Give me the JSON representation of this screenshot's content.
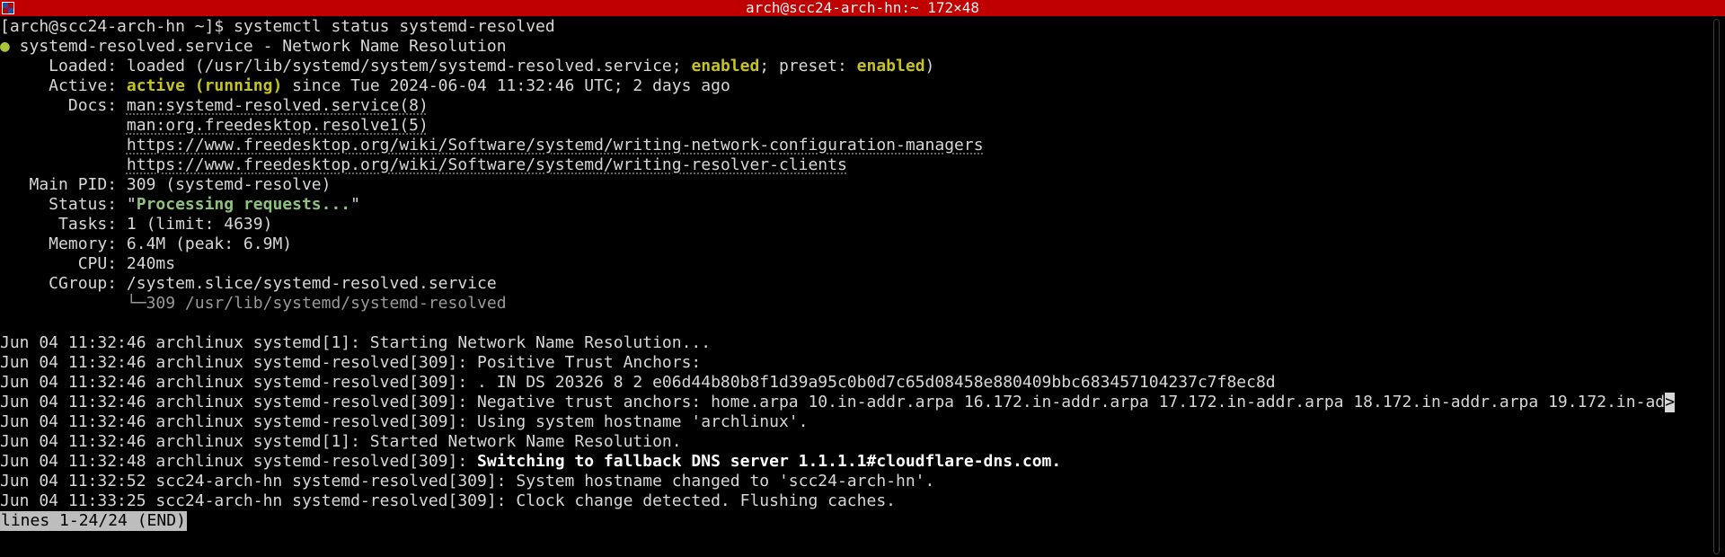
{
  "window": {
    "title": "arch@scc24-arch-hn:~ 172×48",
    "icon": "terminal-app-icon"
  },
  "colors": {
    "titlebar_bg": "#c00000",
    "background": "#000000",
    "text": "#d7d7d7",
    "highlight_yellow": "#c6c31d",
    "highlight_green": "#a9c53a"
  },
  "prompt": {
    "text": "[arch@scc24-arch-hn ~]$ ",
    "command": "systemctl status systemd-resolved"
  },
  "service": {
    "bullet": "●",
    "header": " systemd-resolved.service - Network Name Resolution",
    "loaded_label": "     Loaded: ",
    "loaded_pre": "loaded (/usr/lib/systemd/system/systemd-resolved.service; ",
    "loaded_enabled": "enabled",
    "loaded_mid": "; preset: ",
    "loaded_preset": "enabled",
    "loaded_post": ")",
    "active_label": "     Active: ",
    "active_state": "active (running)",
    "active_since": " since Tue 2024-06-04 11:32:46 UTC; 2 days ago",
    "docs_label": "       Docs: ",
    "docs": [
      "man:systemd-resolved.service(8)",
      "man:org.freedesktop.resolve1(5)",
      "https://www.freedesktop.org/wiki/Software/systemd/writing-network-configuration-managers",
      "https://www.freedesktop.org/wiki/Software/systemd/writing-resolver-clients"
    ],
    "docs_indent": "             ",
    "main_pid_label": "   Main PID: ",
    "main_pid": "309 (systemd-resolve)",
    "status_label": "     Status: ",
    "status_q1": "\"",
    "status_value": "Processing requests...",
    "status_q2": "\"",
    "tasks_label": "      Tasks: ",
    "tasks": "1 (limit: 4639)",
    "memory_label": "     Memory: ",
    "memory": "6.4M (peak: 6.9M)",
    "cpu_label": "        CPU: ",
    "cpu": "240ms",
    "cgroup_label": "     CGroup: ",
    "cgroup": "/system.slice/systemd-resolved.service",
    "cgroup_child_indent": "             ",
    "cgroup_child": "└─309 /usr/lib/systemd/systemd-resolved"
  },
  "journal": [
    "Jun 04 11:32:46 archlinux systemd[1]: Starting Network Name Resolution...",
    "Jun 04 11:32:46 archlinux systemd-resolved[309]: Positive Trust Anchors:",
    "Jun 04 11:32:46 archlinux systemd-resolved[309]: . IN DS 20326 8 2 e06d44b80b8f1d39a95c0b0d7c65d08458e880409bbc683457104237c7f8ec8d",
    "Jun 04 11:32:46 archlinux systemd-resolved[309]: Negative trust anchors: home.arpa 10.in-addr.arpa 16.172.in-addr.arpa 17.172.in-addr.arpa 18.172.in-addr.arpa 19.172.in-ad",
    "Jun 04 11:32:46 archlinux systemd-resolved[309]: Using system hostname 'archlinux'.",
    "Jun 04 11:32:46 archlinux systemd[1]: Started Network Name Resolution.",
    "Jun 04 11:32:48 archlinux systemd-resolved[309]: ",
    "Jun 04 11:32:52 scc24-arch-hn systemd-resolved[309]: System hostname changed to 'scc24-arch-hn'.",
    "Jun 04 11:33:25 scc24-arch-hn systemd-resolved[309]: Clock change detected. Flushing caches."
  ],
  "journal_bold_msg": "Switching to fallback DNS server 1.1.1.1#cloudflare-dns.com.",
  "truncation_marker": ">",
  "pager_status": "lines 1-24/24 (END)"
}
